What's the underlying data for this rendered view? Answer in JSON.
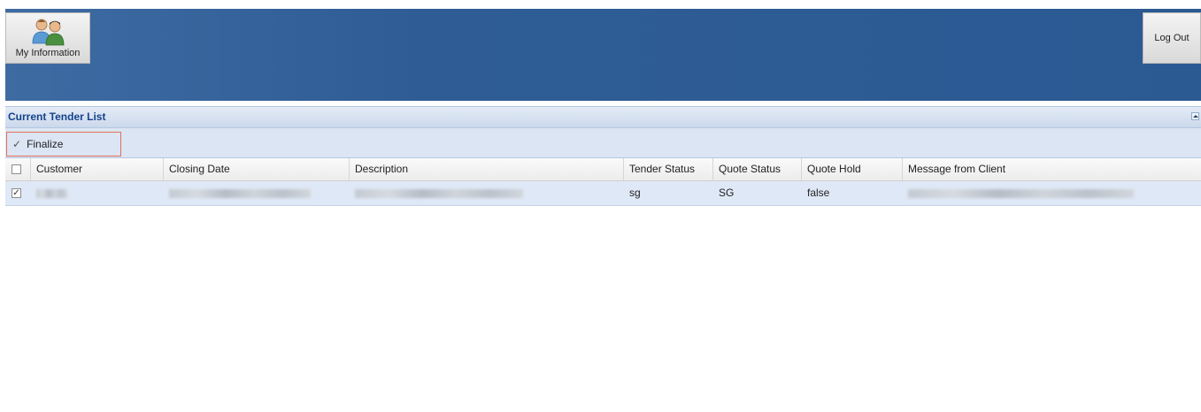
{
  "header": {
    "my_information_label": "My Information",
    "log_out_label": "Log Out",
    "icon": "users-icon"
  },
  "panel": {
    "title": "Current Tender List",
    "collapse_icon": "collapse-up-icon"
  },
  "toolbar": {
    "finalize_label": "Finalize",
    "finalize_icon": "check-icon",
    "check_glyph": "✓"
  },
  "grid": {
    "columns": [
      {
        "key": "customer",
        "label": "Customer"
      },
      {
        "key": "closing_date",
        "label": "Closing Date"
      },
      {
        "key": "description",
        "label": "Description"
      },
      {
        "key": "tender_status",
        "label": "Tender Status"
      },
      {
        "key": "quote_status",
        "label": "Quote Status"
      },
      {
        "key": "quote_hold",
        "label": "Quote Hold"
      },
      {
        "key": "message_from_client",
        "label": "Message from Client"
      }
    ],
    "rows": [
      {
        "selected": true,
        "checkbox_glyph": "✓",
        "customer": "",
        "closing_date": "",
        "description": "",
        "tender_status": "sg",
        "quote_status": "SG",
        "quote_hold": "false",
        "message_from_client": ""
      }
    ]
  },
  "colors": {
    "header_blue": "#2b5a93",
    "panel_title_text": "#15428b",
    "selected_row": "#dfe8f6",
    "finalize_highlight": "#e4705c"
  }
}
